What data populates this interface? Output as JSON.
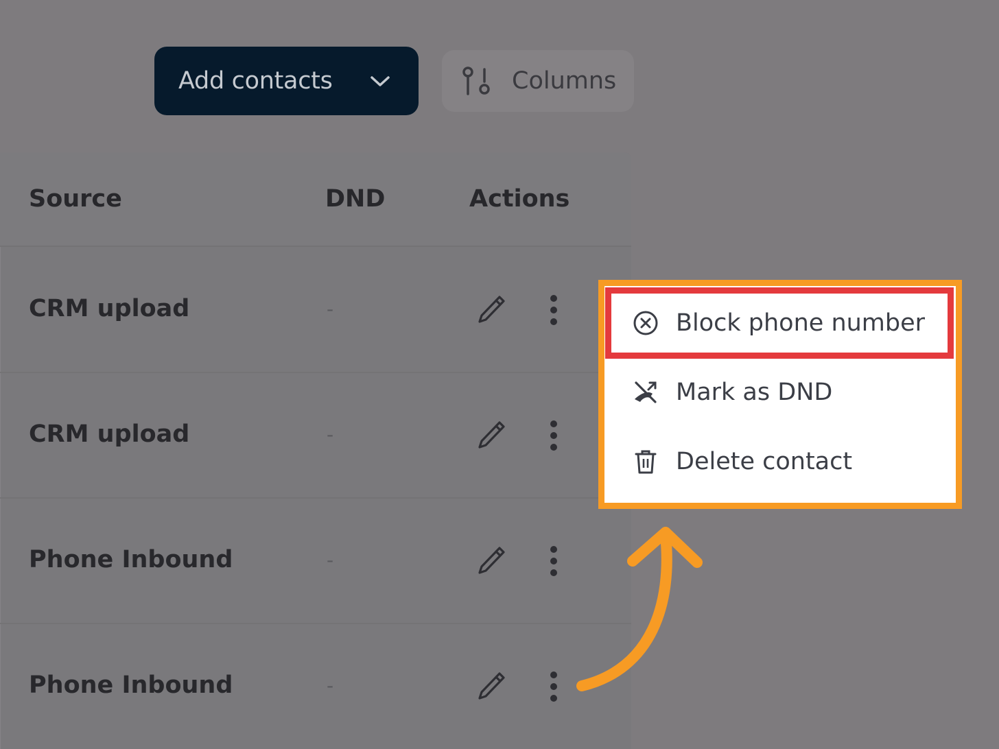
{
  "toolbar": {
    "add_contacts_label": "Add contacts",
    "columns_label": "Columns"
  },
  "table": {
    "headers": [
      "Source",
      "DND",
      "Actions"
    ],
    "rows": [
      {
        "source": "CRM upload",
        "dnd": "-"
      },
      {
        "source": "CRM upload",
        "dnd": "-"
      },
      {
        "source": "Phone Inbound",
        "dnd": "-"
      },
      {
        "source": "Phone Inbound",
        "dnd": "-"
      }
    ]
  },
  "menu": {
    "items": [
      {
        "label": "Block phone number",
        "icon": "block-circle-icon"
      },
      {
        "label": "Mark as DND",
        "icon": "phone-off-icon"
      },
      {
        "label": "Delete contact",
        "icon": "trash-icon"
      }
    ]
  },
  "annotation": {
    "outer_highlight_color": "#f79b24",
    "inner_highlight_color": "#e43a3d",
    "arrow_color": "#f79b24"
  }
}
